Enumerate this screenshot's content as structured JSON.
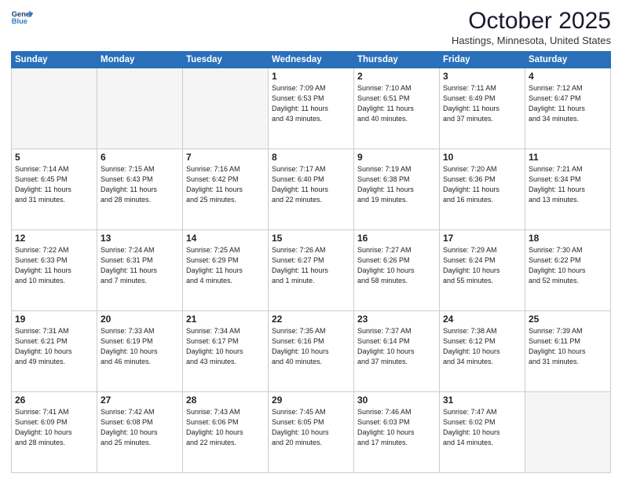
{
  "logo": {
    "line1": "General",
    "line2": "Blue"
  },
  "title": "October 2025",
  "location": "Hastings, Minnesota, United States",
  "days_of_week": [
    "Sunday",
    "Monday",
    "Tuesday",
    "Wednesday",
    "Thursday",
    "Friday",
    "Saturday"
  ],
  "weeks": [
    [
      {
        "num": "",
        "info": ""
      },
      {
        "num": "",
        "info": ""
      },
      {
        "num": "",
        "info": ""
      },
      {
        "num": "1",
        "info": "Sunrise: 7:09 AM\nSunset: 6:53 PM\nDaylight: 11 hours\nand 43 minutes."
      },
      {
        "num": "2",
        "info": "Sunrise: 7:10 AM\nSunset: 6:51 PM\nDaylight: 11 hours\nand 40 minutes."
      },
      {
        "num": "3",
        "info": "Sunrise: 7:11 AM\nSunset: 6:49 PM\nDaylight: 11 hours\nand 37 minutes."
      },
      {
        "num": "4",
        "info": "Sunrise: 7:12 AM\nSunset: 6:47 PM\nDaylight: 11 hours\nand 34 minutes."
      }
    ],
    [
      {
        "num": "5",
        "info": "Sunrise: 7:14 AM\nSunset: 6:45 PM\nDaylight: 11 hours\nand 31 minutes."
      },
      {
        "num": "6",
        "info": "Sunrise: 7:15 AM\nSunset: 6:43 PM\nDaylight: 11 hours\nand 28 minutes."
      },
      {
        "num": "7",
        "info": "Sunrise: 7:16 AM\nSunset: 6:42 PM\nDaylight: 11 hours\nand 25 minutes."
      },
      {
        "num": "8",
        "info": "Sunrise: 7:17 AM\nSunset: 6:40 PM\nDaylight: 11 hours\nand 22 minutes."
      },
      {
        "num": "9",
        "info": "Sunrise: 7:19 AM\nSunset: 6:38 PM\nDaylight: 11 hours\nand 19 minutes."
      },
      {
        "num": "10",
        "info": "Sunrise: 7:20 AM\nSunset: 6:36 PM\nDaylight: 11 hours\nand 16 minutes."
      },
      {
        "num": "11",
        "info": "Sunrise: 7:21 AM\nSunset: 6:34 PM\nDaylight: 11 hours\nand 13 minutes."
      }
    ],
    [
      {
        "num": "12",
        "info": "Sunrise: 7:22 AM\nSunset: 6:33 PM\nDaylight: 11 hours\nand 10 minutes."
      },
      {
        "num": "13",
        "info": "Sunrise: 7:24 AM\nSunset: 6:31 PM\nDaylight: 11 hours\nand 7 minutes."
      },
      {
        "num": "14",
        "info": "Sunrise: 7:25 AM\nSunset: 6:29 PM\nDaylight: 11 hours\nand 4 minutes."
      },
      {
        "num": "15",
        "info": "Sunrise: 7:26 AM\nSunset: 6:27 PM\nDaylight: 11 hours\nand 1 minute."
      },
      {
        "num": "16",
        "info": "Sunrise: 7:27 AM\nSunset: 6:26 PM\nDaylight: 10 hours\nand 58 minutes."
      },
      {
        "num": "17",
        "info": "Sunrise: 7:29 AM\nSunset: 6:24 PM\nDaylight: 10 hours\nand 55 minutes."
      },
      {
        "num": "18",
        "info": "Sunrise: 7:30 AM\nSunset: 6:22 PM\nDaylight: 10 hours\nand 52 minutes."
      }
    ],
    [
      {
        "num": "19",
        "info": "Sunrise: 7:31 AM\nSunset: 6:21 PM\nDaylight: 10 hours\nand 49 minutes."
      },
      {
        "num": "20",
        "info": "Sunrise: 7:33 AM\nSunset: 6:19 PM\nDaylight: 10 hours\nand 46 minutes."
      },
      {
        "num": "21",
        "info": "Sunrise: 7:34 AM\nSunset: 6:17 PM\nDaylight: 10 hours\nand 43 minutes."
      },
      {
        "num": "22",
        "info": "Sunrise: 7:35 AM\nSunset: 6:16 PM\nDaylight: 10 hours\nand 40 minutes."
      },
      {
        "num": "23",
        "info": "Sunrise: 7:37 AM\nSunset: 6:14 PM\nDaylight: 10 hours\nand 37 minutes."
      },
      {
        "num": "24",
        "info": "Sunrise: 7:38 AM\nSunset: 6:12 PM\nDaylight: 10 hours\nand 34 minutes."
      },
      {
        "num": "25",
        "info": "Sunrise: 7:39 AM\nSunset: 6:11 PM\nDaylight: 10 hours\nand 31 minutes."
      }
    ],
    [
      {
        "num": "26",
        "info": "Sunrise: 7:41 AM\nSunset: 6:09 PM\nDaylight: 10 hours\nand 28 minutes."
      },
      {
        "num": "27",
        "info": "Sunrise: 7:42 AM\nSunset: 6:08 PM\nDaylight: 10 hours\nand 25 minutes."
      },
      {
        "num": "28",
        "info": "Sunrise: 7:43 AM\nSunset: 6:06 PM\nDaylight: 10 hours\nand 22 minutes."
      },
      {
        "num": "29",
        "info": "Sunrise: 7:45 AM\nSunset: 6:05 PM\nDaylight: 10 hours\nand 20 minutes."
      },
      {
        "num": "30",
        "info": "Sunrise: 7:46 AM\nSunset: 6:03 PM\nDaylight: 10 hours\nand 17 minutes."
      },
      {
        "num": "31",
        "info": "Sunrise: 7:47 AM\nSunset: 6:02 PM\nDaylight: 10 hours\nand 14 minutes."
      },
      {
        "num": "",
        "info": ""
      }
    ]
  ]
}
